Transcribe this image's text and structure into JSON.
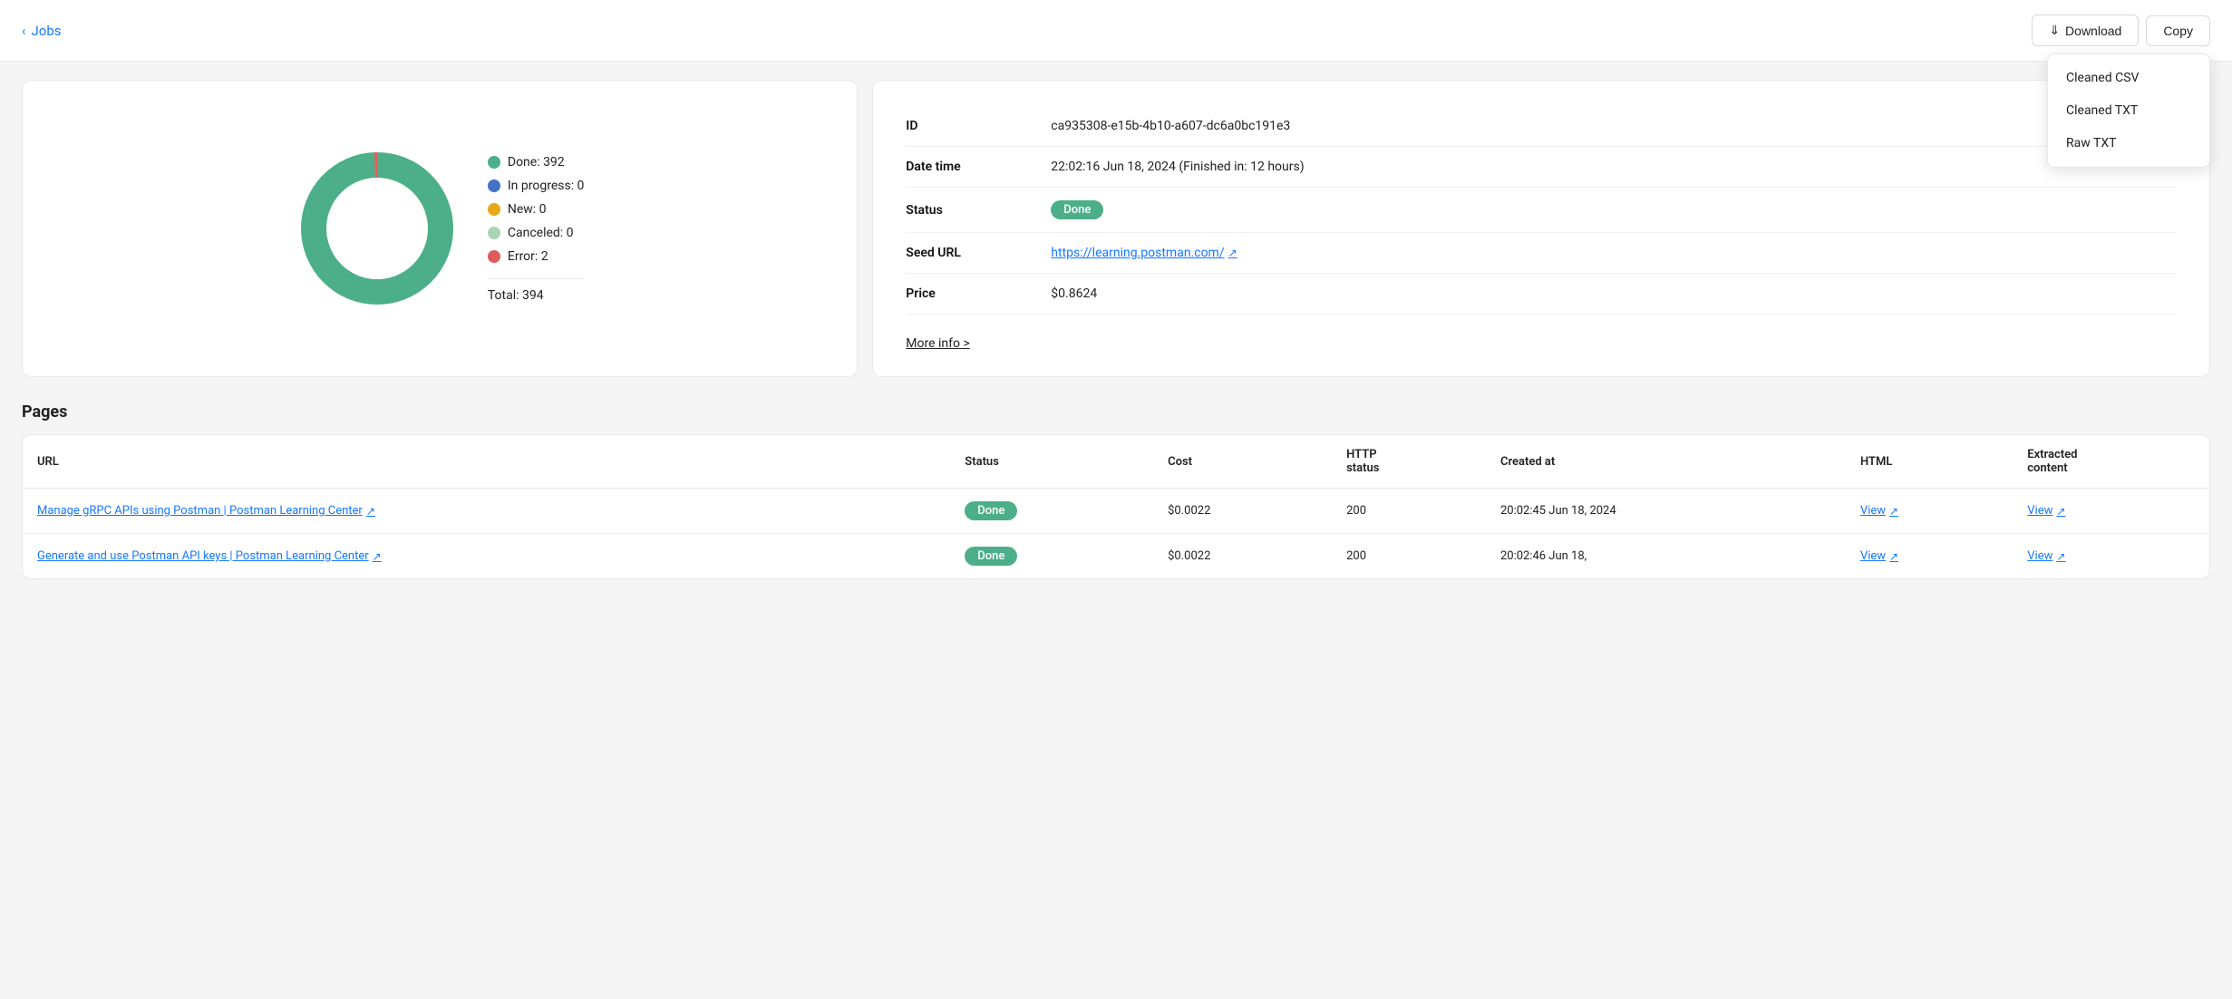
{
  "header": {
    "back_label": "Jobs",
    "download_label": "Download",
    "copy_label": "Copy",
    "dropdown": {
      "items": [
        {
          "label": "Cleaned CSV"
        },
        {
          "label": "Cleaned TXT"
        },
        {
          "label": "Raw TXT"
        }
      ]
    }
  },
  "donut": {
    "segments": [
      {
        "label": "Done",
        "count": 392,
        "color": "#4caf8a",
        "percent": 99.5
      },
      {
        "label": "In progress",
        "count": 0,
        "color": "#4472C4",
        "percent": 0
      },
      {
        "label": "New",
        "count": 0,
        "color": "#E6A817",
        "percent": 0
      },
      {
        "label": "Canceled",
        "count": 0,
        "color": "#a8d5b5",
        "percent": 0
      },
      {
        "label": "Error",
        "count": 2,
        "color": "#e05c5c",
        "percent": 0.5
      }
    ],
    "total_label": "Total: 394",
    "total": 394
  },
  "job_info": {
    "id_label": "ID",
    "id_value": "ca935308-e15b-4b10-a607-dc6a0bc191e3",
    "datetime_label": "Date time",
    "datetime_value": "22:02:16 Jun 18, 2024 (Finished in: 12 hours)",
    "status_label": "Status",
    "status_value": "Done",
    "seed_url_label": "Seed URL",
    "seed_url_value": "https://learning.postman.com/",
    "price_label": "Price",
    "price_value": "$0.8624",
    "more_info_label": "More info >"
  },
  "pages": {
    "title": "Pages",
    "columns": [
      "URL",
      "Status",
      "Cost",
      "HTTP status",
      "Created at",
      "HTML",
      "Extracted content"
    ],
    "rows": [
      {
        "url": "Manage gRPC APIs using Postman | Postman Learning Center",
        "status": "Done",
        "cost": "$0.0022",
        "http_status": "200",
        "created_at": "20:02:45 Jun 18, 2024",
        "html_link": "View",
        "extracted_link": "View"
      },
      {
        "url": "Generate and use Postman API keys | Postman Learning Center",
        "status": "Done",
        "cost": "$0.0022",
        "http_status": "200",
        "created_at": "20:02:46 Jun 18,",
        "html_link": "View",
        "extracted_link": "View"
      }
    ]
  }
}
